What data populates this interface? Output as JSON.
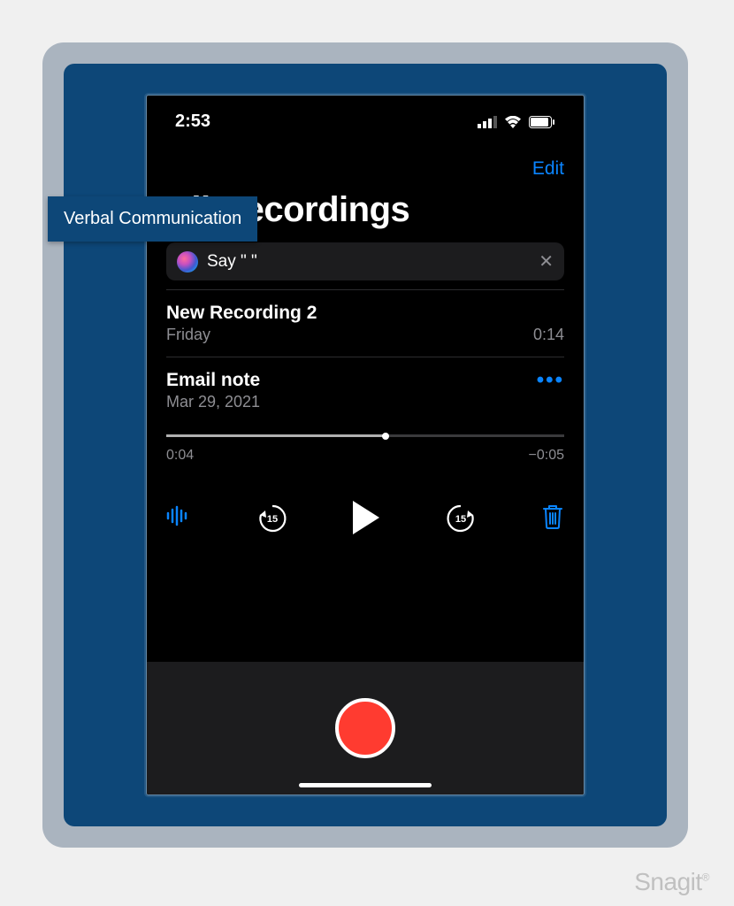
{
  "annotation": {
    "label": "Verbal Communication"
  },
  "status_bar": {
    "time": "2:53"
  },
  "nav": {
    "edit": "Edit"
  },
  "page": {
    "title": "All Recordings"
  },
  "siri": {
    "text": "Say \" \""
  },
  "list": [
    {
      "title": "New Recording 2",
      "subtitle": "Friday",
      "duration": "0:14"
    }
  ],
  "expanded": {
    "title": "Email note",
    "subtitle": "Mar 29, 2021",
    "elapsed": "0:04",
    "remaining": "−0:05",
    "skip_back": "15",
    "skip_fwd": "15"
  },
  "watermark": "Snagit"
}
